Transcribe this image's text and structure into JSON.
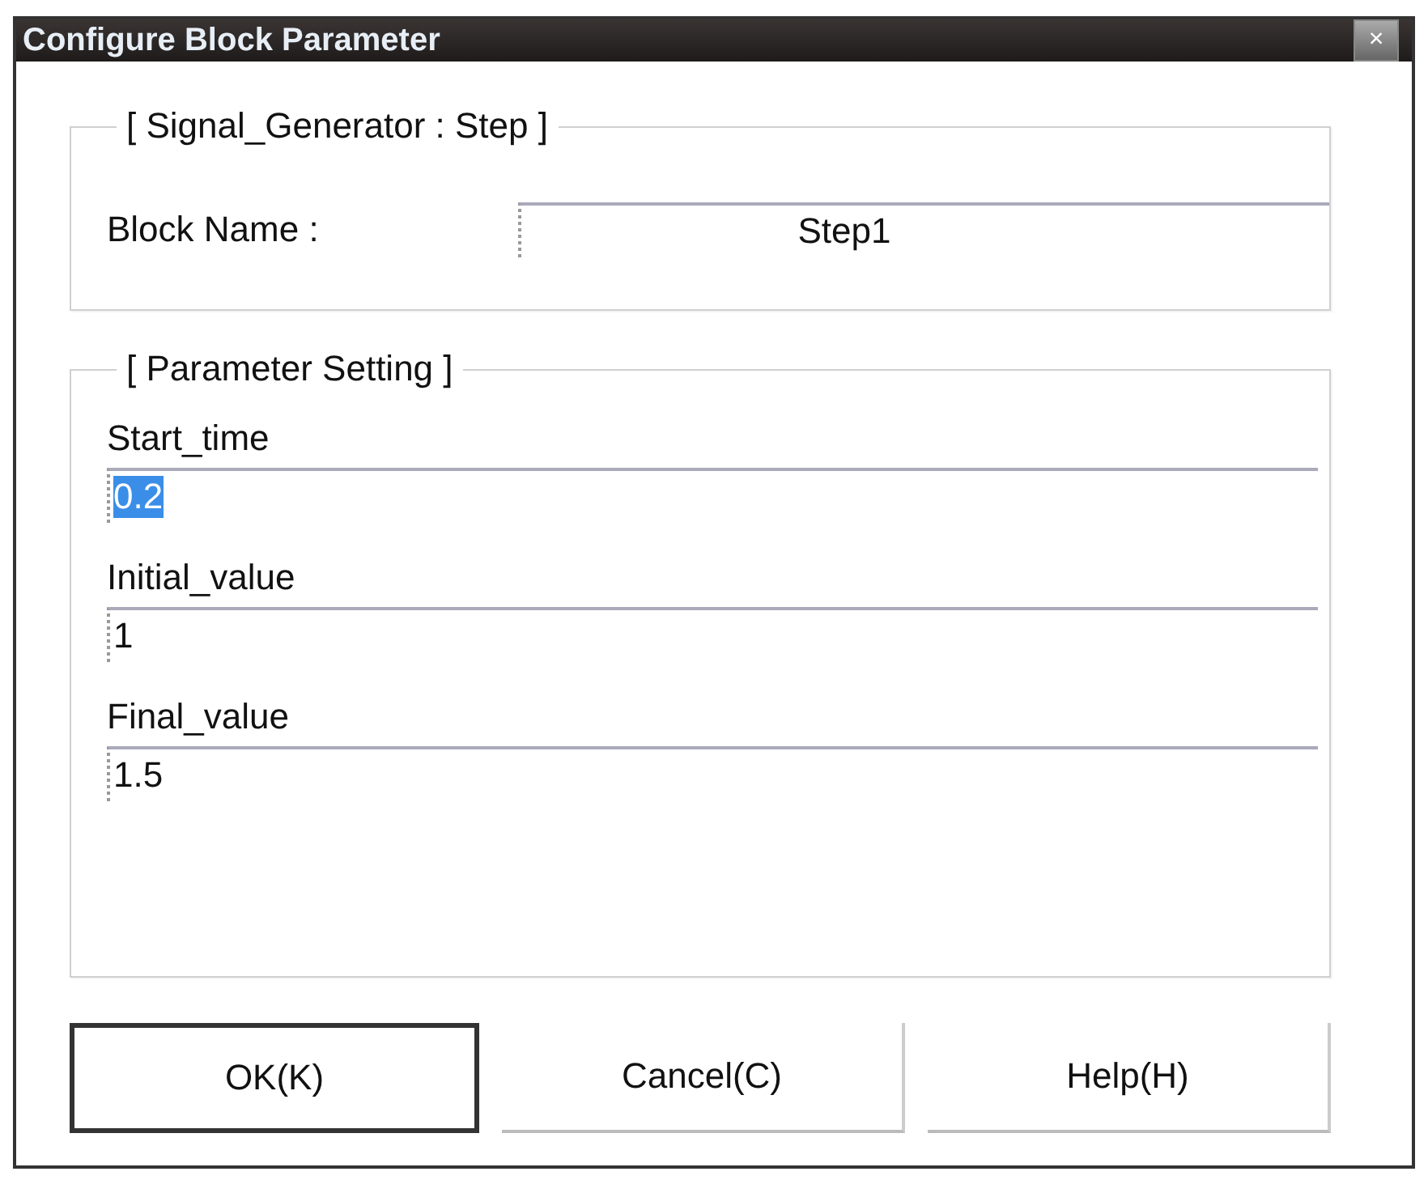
{
  "window": {
    "title": "Configure Block Parameter",
    "close": "×"
  },
  "block_group": {
    "title": "[ Signal_Generator : Step ]",
    "label": "Block Name :",
    "value": "Step1"
  },
  "parameter_group": {
    "title": "[ Parameter Setting ]",
    "params": [
      {
        "label": "Start_time",
        "value": "0.2",
        "text_selected": true
      },
      {
        "label": "Initial_value",
        "value": "1",
        "text_selected": false
      },
      {
        "label": "Final_value",
        "value": "1.5",
        "text_selected": false
      }
    ]
  },
  "buttons": [
    {
      "label": "OK(K)",
      "default": true
    },
    {
      "label": "Cancel(C)",
      "default": false
    },
    {
      "label": "Help(H)",
      "default": false
    }
  ]
}
